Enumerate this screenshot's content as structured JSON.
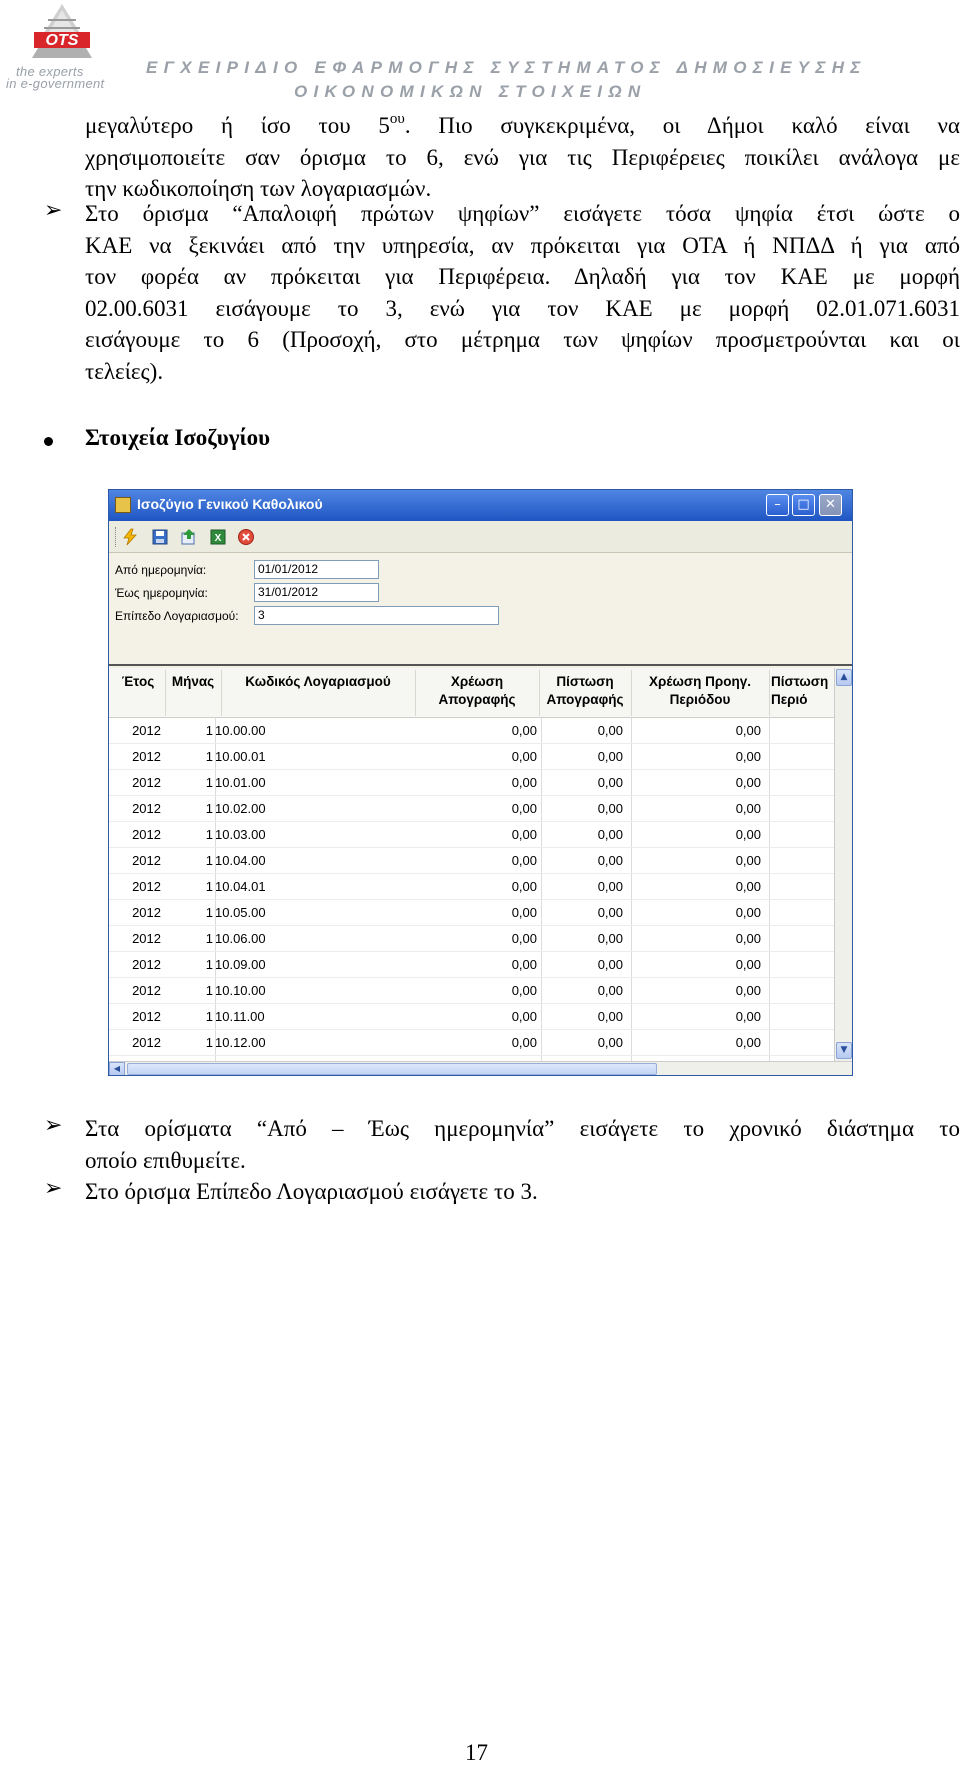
{
  "header": {
    "logo_brand": "OTS",
    "logo_tagline_1": "the experts",
    "logo_tagline_2": "in e-government",
    "title_line_1": "ΕΓΧΕΙΡΙΔΙΟ ΕΦΑΡΜΟΓΗΣ ΣΥΣΤΗΜΑΤΟΣ ΔΗΜΟΣΙΕΥΣΗΣ",
    "title_line_2": "ΟΙΚΟΝΟΜΙΚΩΝ ΣΤΟΙΧΕΙΩΝ"
  },
  "paragraph_1": {
    "line_1_before_sup": "μεγαλύτερο ή ίσο του 5",
    "line_1_sup": "ου",
    "line_1_after_sup": ". Πιο συγκεκριμένα, οι Δήμοι καλό είναι να",
    "line_2": "χρησιμοποιείτε σαν όρισμα το 6, ενώ για τις Περιφέρειες ποικίλει ανάλογα με",
    "line_3": "την κωδικοποίηση των λογαριασμών."
  },
  "paragraph_2": {
    "line_1": "Στο όρισμα “Απαλοιφή πρώτων ψηφίων” εισάγετε τόσα ψηφία έτσι ώστε ο",
    "line_2": "ΚΑΕ να ξεκινάει από την υπηρεσία, αν πρόκειται για ΟΤΑ ή ΝΠΔΔ ή για από",
    "line_3": "τον φορέα αν πρόκειται για Περιφέρεια. Δηλαδή για τον ΚΑΕ με μορφή",
    "line_4": "02.00.6031 εισάγουμε το 3, ενώ για τον ΚΑΕ με μορφή 02.01.071.6031",
    "line_5": "εισάγουμε το 6 (Προσοχή, στο μέτρημα των ψηφίων προσμετρούνται και οι",
    "line_6": "τελείες)."
  },
  "section_title": "Στοιχεία Ισοζυγίου",
  "window": {
    "title": "Ισοζύγιο Γενικού Καθολικού",
    "min_glyph": "–",
    "max_glyph": "□",
    "close_glyph": "✕",
    "form": {
      "from_date_label": "Από ημερομηνία:",
      "from_date_value": "01/01/2012",
      "to_date_label": "Έως ημερομηνία:",
      "to_date_value": "31/01/2012",
      "level_label": "Επίπεδο Λογαριασμού:",
      "level_value": "3"
    },
    "columns": {
      "year": "Έτος",
      "month": "Μήνας",
      "code": "Κωδικός Λογαριασμού",
      "debit_inv_1": "Χρέωση",
      "debit_inv_2": "Απογραφής",
      "credit_inv_1": "Πίστωση",
      "credit_inv_2": "Απογραφής",
      "debit_prev_1": "Χρέωση Προηγ.",
      "debit_prev_2": "Περιόδου",
      "credit_prev_1": "Πίστωση",
      "credit_prev_2": "Περιό"
    },
    "rows": [
      {
        "year": "2012",
        "month": "1",
        "code": "10.00.00",
        "v1": "0,00",
        "v2": "0,00",
        "v3": "0,00"
      },
      {
        "year": "2012",
        "month": "1",
        "code": "10.00.01",
        "v1": "0,00",
        "v2": "0,00",
        "v3": "0,00"
      },
      {
        "year": "2012",
        "month": "1",
        "code": "10.01.00",
        "v1": "0,00",
        "v2": "0,00",
        "v3": "0,00"
      },
      {
        "year": "2012",
        "month": "1",
        "code": "10.02.00",
        "v1": "0,00",
        "v2": "0,00",
        "v3": "0,00"
      },
      {
        "year": "2012",
        "month": "1",
        "code": "10.03.00",
        "v1": "0,00",
        "v2": "0,00",
        "v3": "0,00"
      },
      {
        "year": "2012",
        "month": "1",
        "code": "10.04.00",
        "v1": "0,00",
        "v2": "0,00",
        "v3": "0,00"
      },
      {
        "year": "2012",
        "month": "1",
        "code": "10.04.01",
        "v1": "0,00",
        "v2": "0,00",
        "v3": "0,00"
      },
      {
        "year": "2012",
        "month": "1",
        "code": "10.05.00",
        "v1": "0,00",
        "v2": "0,00",
        "v3": "0,00"
      },
      {
        "year": "2012",
        "month": "1",
        "code": "10.06.00",
        "v1": "0,00",
        "v2": "0,00",
        "v3": "0,00"
      },
      {
        "year": "2012",
        "month": "1",
        "code": "10.09.00",
        "v1": "0,00",
        "v2": "0,00",
        "v3": "0,00"
      },
      {
        "year": "2012",
        "month": "1",
        "code": "10.10.00",
        "v1": "0,00",
        "v2": "0,00",
        "v3": "0,00"
      },
      {
        "year": "2012",
        "month": "1",
        "code": "10.11.00",
        "v1": "0,00",
        "v2": "0,00",
        "v3": "0,00"
      },
      {
        "year": "2012",
        "month": "1",
        "code": "10.12.00",
        "v1": "0,00",
        "v2": "0,00",
        "v3": "0,00"
      }
    ],
    "toolbar_icons": [
      "lightning-icon",
      "save-icon",
      "export-icon",
      "excel-icon",
      "close-icon"
    ]
  },
  "paragraph_3": {
    "line_1": "Στα ορίσματα “Από – Έως ημερομηνία” εισάγετε το χρονικό διάστημα το",
    "line_2": "οποίο επιθυμείτε."
  },
  "paragraph_4": {
    "line_1": "Στο όρισμα Επίπεδο Λογαριασμού εισάγετε το 3."
  },
  "bullet_glyph": "➢",
  "page_number": "17",
  "colors": {
    "header_gray": "#9aa0a8",
    "logo_red": "#d8262a",
    "titlebar_blue": "#2a5fd0"
  }
}
